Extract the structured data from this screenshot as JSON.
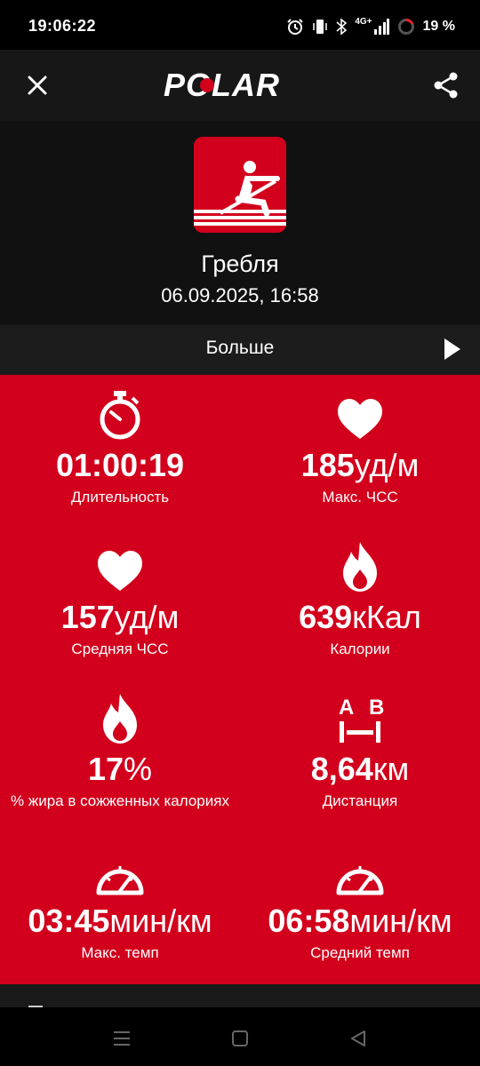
{
  "status_bar": {
    "time": "19:06:22",
    "network": "4G+",
    "battery": "19 %"
  },
  "header": {
    "brand": "POLAR"
  },
  "sport": {
    "name": "Гребля",
    "datetime": "06.09.2025, 16:58"
  },
  "more": {
    "label": "Больше"
  },
  "stats": [
    {
      "icon": "stopwatch-icon",
      "value": "01:00:19",
      "unit": "",
      "label": "Длительность"
    },
    {
      "icon": "heart-icon",
      "value": "185",
      "unit": "уд/м",
      "label": "Макс. ЧСС"
    },
    {
      "icon": "heart-icon",
      "value": "157",
      "unit": "уд/м",
      "label": "Средняя ЧСС"
    },
    {
      "icon": "flame-icon",
      "value": "639",
      "unit": "кКал",
      "label": "Калории"
    },
    {
      "icon": "flame-icon",
      "value": "17",
      "unit": "%",
      "label": "% жира в сожженных калориях"
    },
    {
      "icon": "distance-ab-icon",
      "value": "8,64",
      "unit": "км",
      "label": "Дистанция"
    },
    {
      "icon": "speedometer-icon",
      "value": "03:45",
      "unit": "мин/км",
      "label": "Макс. темп"
    },
    {
      "icon": "speedometer-icon",
      "value": "06:58",
      "unit": "мин/км",
      "label": "Средний темп"
    }
  ],
  "distance_icon_text": {
    "a": "A",
    "b": "B"
  },
  "colors": {
    "accent": "#d2001c",
    "background": "#111111",
    "topbar": "#171717"
  }
}
